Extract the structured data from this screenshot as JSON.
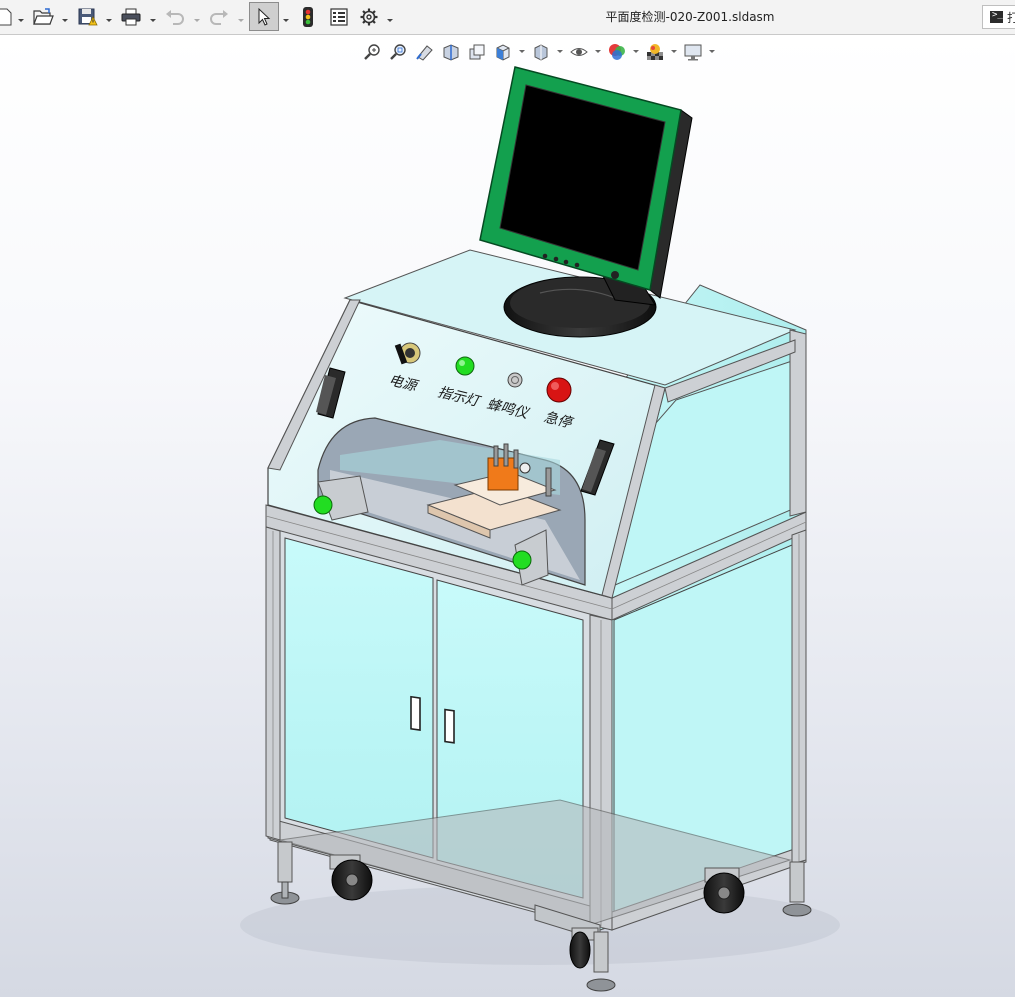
{
  "window": {
    "document_title": "平面度检测-020-Z001.sldasm",
    "command_search_text": "打"
  },
  "toolbar": {
    "items": [
      {
        "icon": "new-document-icon"
      },
      {
        "icon": "open-folder-icon"
      },
      {
        "icon": "save-icon"
      },
      {
        "icon": "print-icon"
      },
      {
        "icon": "undo-icon"
      },
      {
        "icon": "redo-icon"
      },
      {
        "icon": "select-arrow-icon"
      },
      {
        "icon": "rebuild-traffic-light-icon"
      },
      {
        "icon": "file-properties-icon"
      },
      {
        "icon": "options-gear-icon"
      }
    ]
  },
  "heads_up_toolbar": {
    "items": [
      {
        "icon": "zoom-to-fit-icon"
      },
      {
        "icon": "zoom-to-area-icon"
      },
      {
        "icon": "previous-view-icon"
      },
      {
        "icon": "section-view-icon"
      },
      {
        "icon": "dynamic-annotation-icon"
      },
      {
        "icon": "view-orientation-icon"
      },
      {
        "icon": "display-style-icon"
      },
      {
        "icon": "hide-show-items-icon"
      },
      {
        "icon": "edit-appearance-icon"
      },
      {
        "icon": "apply-scene-icon"
      },
      {
        "icon": "view-settings-icon"
      }
    ]
  },
  "model": {
    "panel_labels": {
      "power": "电源",
      "indicator": "指示灯",
      "buzzer": "蜂鸣仪",
      "emergency_stop": "急停"
    },
    "colors": {
      "panel": "#ddf7f8",
      "door": "#bef7f6",
      "frame": "#c9ccd0",
      "monitor_bezel": "#13a04e",
      "screen": "#000000",
      "indicator_light": "#22dd22",
      "estop": "#d81414",
      "fixture_orange": "#f07a1a"
    }
  }
}
